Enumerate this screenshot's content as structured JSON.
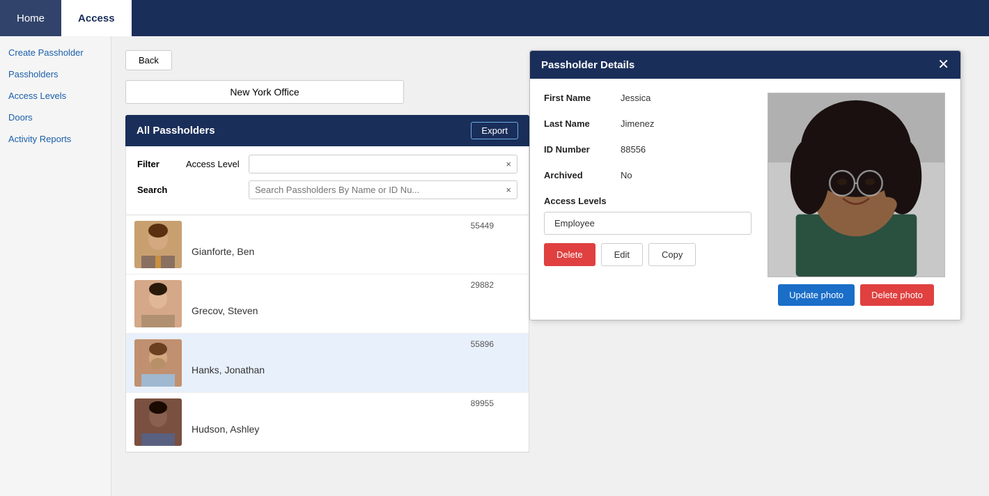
{
  "nav": {
    "tabs": [
      {
        "id": "home",
        "label": "Home",
        "active": false
      },
      {
        "id": "access",
        "label": "Access",
        "active": true
      }
    ]
  },
  "sidebar": {
    "items": [
      {
        "id": "create-passholder",
        "label": "Create Passholder"
      },
      {
        "id": "passholders",
        "label": "Passholders"
      },
      {
        "id": "access-levels",
        "label": "Access Levels"
      },
      {
        "id": "doors",
        "label": "Doors"
      },
      {
        "id": "activity-reports",
        "label": "Activity Reports"
      }
    ]
  },
  "main": {
    "back_label": "Back",
    "office_name": "New York Office",
    "passholders_title": "All Passholders",
    "export_label": "Export",
    "filter": {
      "filter_label": "Filter",
      "access_level_label": "Access Level",
      "access_level_value": "",
      "search_label": "Search",
      "search_placeholder": "Search Passholders By Name or ID Nu..."
    },
    "passholders": [
      {
        "id": "55449",
        "name": "Gianforte, Ben",
        "avatar_color": "#b8906a",
        "avatar_id": "ben"
      },
      {
        "id": "29882",
        "name": "Grecov, Steven",
        "avatar_color": "#c09878",
        "avatar_id": "steven"
      },
      {
        "id": "55896",
        "name": "Hanks, Jonathan",
        "avatar_color": "#a07858",
        "avatar_id": "jonathan",
        "selected": true
      },
      {
        "id": "89955",
        "name": "Hudson, Ashley",
        "avatar_color": "#6a4030",
        "avatar_id": "ashley"
      }
    ]
  },
  "details": {
    "title": "Passholder Details",
    "close_label": "✕",
    "first_name_label": "First Name",
    "first_name_value": "Jessica",
    "last_name_label": "Last Name",
    "last_name_value": "Jimenez",
    "id_number_label": "ID Number",
    "id_number_value": "88556",
    "archived_label": "Archived",
    "archived_value": "No",
    "access_levels_label": "Access Levels",
    "access_level_tag": "Employee",
    "update_photo_label": "Update photo",
    "delete_photo_label": "Delete photo",
    "delete_label": "Delete",
    "edit_label": "Edit",
    "copy_label": "Copy"
  }
}
